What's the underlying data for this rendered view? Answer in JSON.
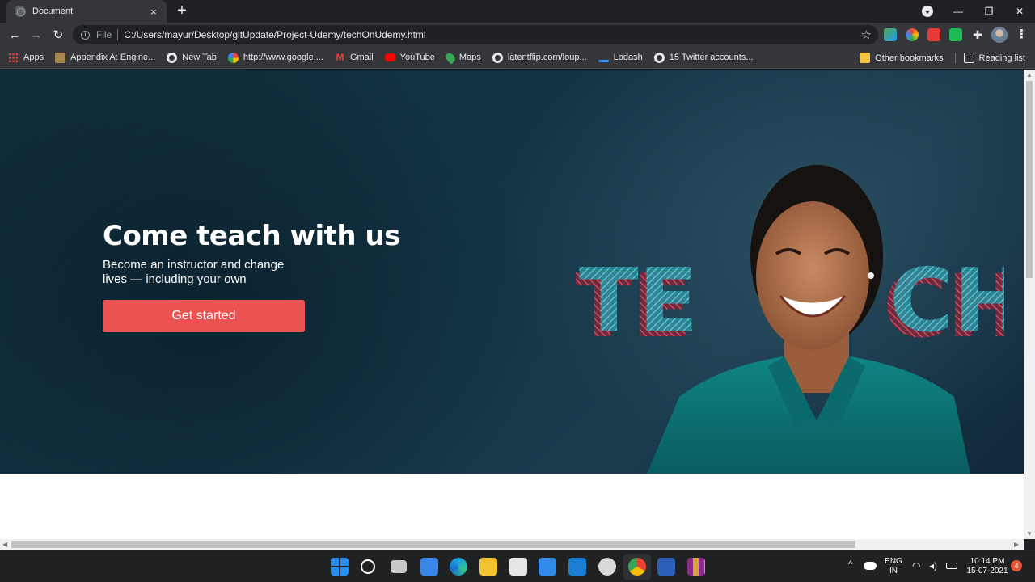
{
  "browser": {
    "tab_title": "Document",
    "tab_close": "×",
    "new_tab": "+",
    "window_controls": {
      "minimize": "—",
      "restore": "❐",
      "close": "✕"
    },
    "nav": {
      "back": "←",
      "forward": "→",
      "reload": "↻"
    },
    "omnibox": {
      "scheme_label": "File",
      "url": "C:/Users/mayur/Desktop/gitUpdate/Project-Udemy/techOnUdemy.html"
    },
    "star": "☆",
    "menu": "⋮"
  },
  "bookmarks": {
    "items": [
      {
        "label": "Apps",
        "icon": "apps-grid-icon"
      },
      {
        "label": "Appendix A: Engine...",
        "icon": "book-icon"
      },
      {
        "label": "New Tab",
        "icon": "globe-icon"
      },
      {
        "label": "http://www.google....",
        "icon": "google-icon"
      },
      {
        "label": "Gmail",
        "icon": "gmail-icon"
      },
      {
        "label": "YouTube",
        "icon": "youtube-icon"
      },
      {
        "label": "Maps",
        "icon": "maps-icon"
      },
      {
        "label": "latentflip.com/loup...",
        "icon": "globe-icon"
      },
      {
        "label": "Lodash",
        "icon": "lodash-icon"
      },
      {
        "label": "15 Twitter accounts...",
        "icon": "globe-icon"
      }
    ],
    "other": "Other bookmarks",
    "reading_list": "Reading list"
  },
  "page": {
    "hero": {
      "title": "Come teach with us",
      "subtitle": "Become an instructor and change lives — including your own",
      "cta": "Get started",
      "overlay_word": "TEACH"
    },
    "colors": {
      "cta": "#ec5252",
      "hero_bg": "#133546",
      "teach_blue": "#3fb3c2",
      "teach_red": "#c2475a"
    }
  },
  "taskbar": {
    "language": "ENG",
    "region": "IN",
    "time": "10:14 PM",
    "date": "15-07-2021",
    "notifications": "4",
    "tray_expand": "^"
  }
}
